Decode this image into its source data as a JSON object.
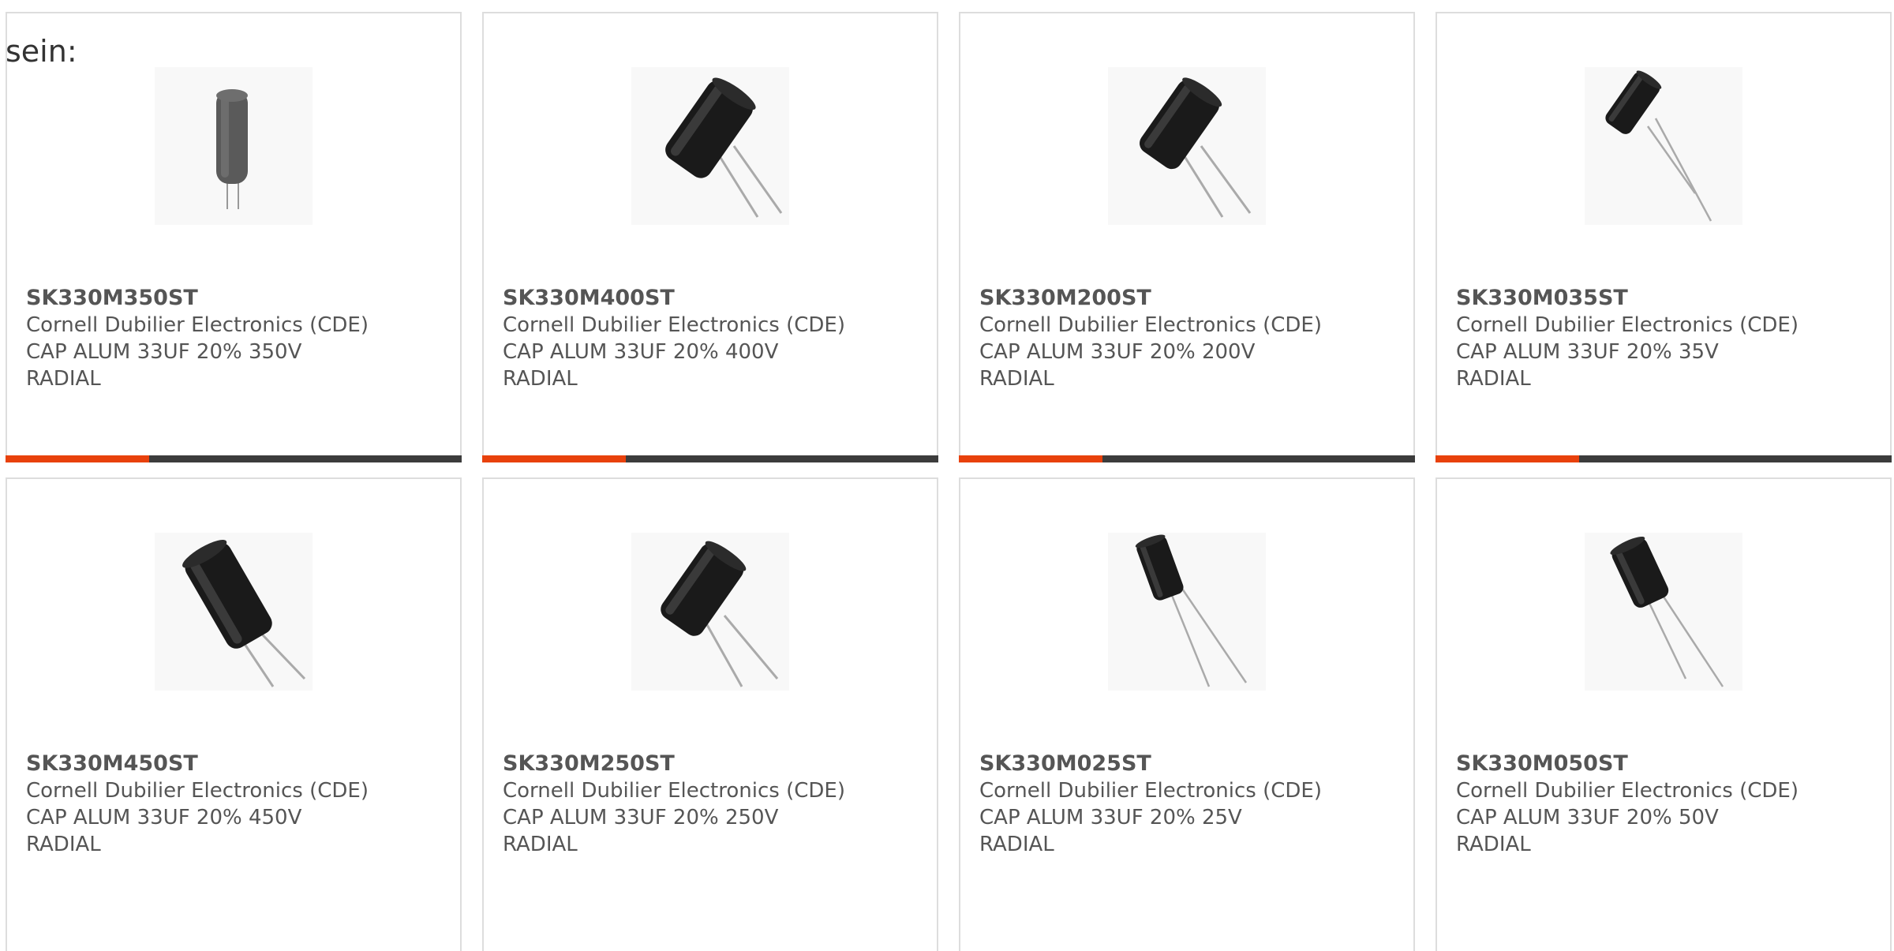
{
  "intro_text": "sein:",
  "colors": {
    "accent": "#e8410c",
    "bar_dark": "#3c3c3c",
    "border": "#dddddd",
    "text": "#555555"
  },
  "products": [
    {
      "part_number": "SK330M350ST",
      "manufacturer": "Cornell Dubilier Electronics (CDE)",
      "description": "CAP ALUM 33UF 20% 350V",
      "package": "RADIAL",
      "image_icon": "capacitor-upright-grey-icon"
    },
    {
      "part_number": "SK330M400ST",
      "manufacturer": "Cornell Dubilier Electronics (CDE)",
      "description": "CAP ALUM 33UF 20% 400V",
      "package": "RADIAL",
      "image_icon": "capacitor-large-icon"
    },
    {
      "part_number": "SK330M200ST",
      "manufacturer": "Cornell Dubilier Electronics (CDE)",
      "description": "CAP ALUM 33UF 20% 200V",
      "package": "RADIAL",
      "image_icon": "capacitor-large-icon"
    },
    {
      "part_number": "SK330M035ST",
      "manufacturer": "Cornell Dubilier Electronics (CDE)",
      "description": "CAP ALUM 33UF 20% 35V",
      "package": "RADIAL",
      "image_icon": "capacitor-small-icon"
    },
    {
      "part_number": "SK330M450ST",
      "manufacturer": "Cornell Dubilier Electronics (CDE)",
      "description": "CAP ALUM 33UF 20% 450V",
      "package": "RADIAL",
      "image_icon": "capacitor-large-icon"
    },
    {
      "part_number": "SK330M250ST",
      "manufacturer": "Cornell Dubilier Electronics (CDE)",
      "description": "CAP ALUM 33UF 20% 250V",
      "package": "RADIAL",
      "image_icon": "capacitor-large-icon"
    },
    {
      "part_number": "SK330M025ST",
      "manufacturer": "Cornell Dubilier Electronics (CDE)",
      "description": "CAP ALUM 33UF 20% 25V",
      "package": "RADIAL",
      "image_icon": "capacitor-small-icon"
    },
    {
      "part_number": "SK330M050ST",
      "manufacturer": "Cornell Dubilier Electronics (CDE)",
      "description": "CAP ALUM 33UF 20% 50V",
      "package": "RADIAL",
      "image_icon": "capacitor-small-icon"
    }
  ]
}
